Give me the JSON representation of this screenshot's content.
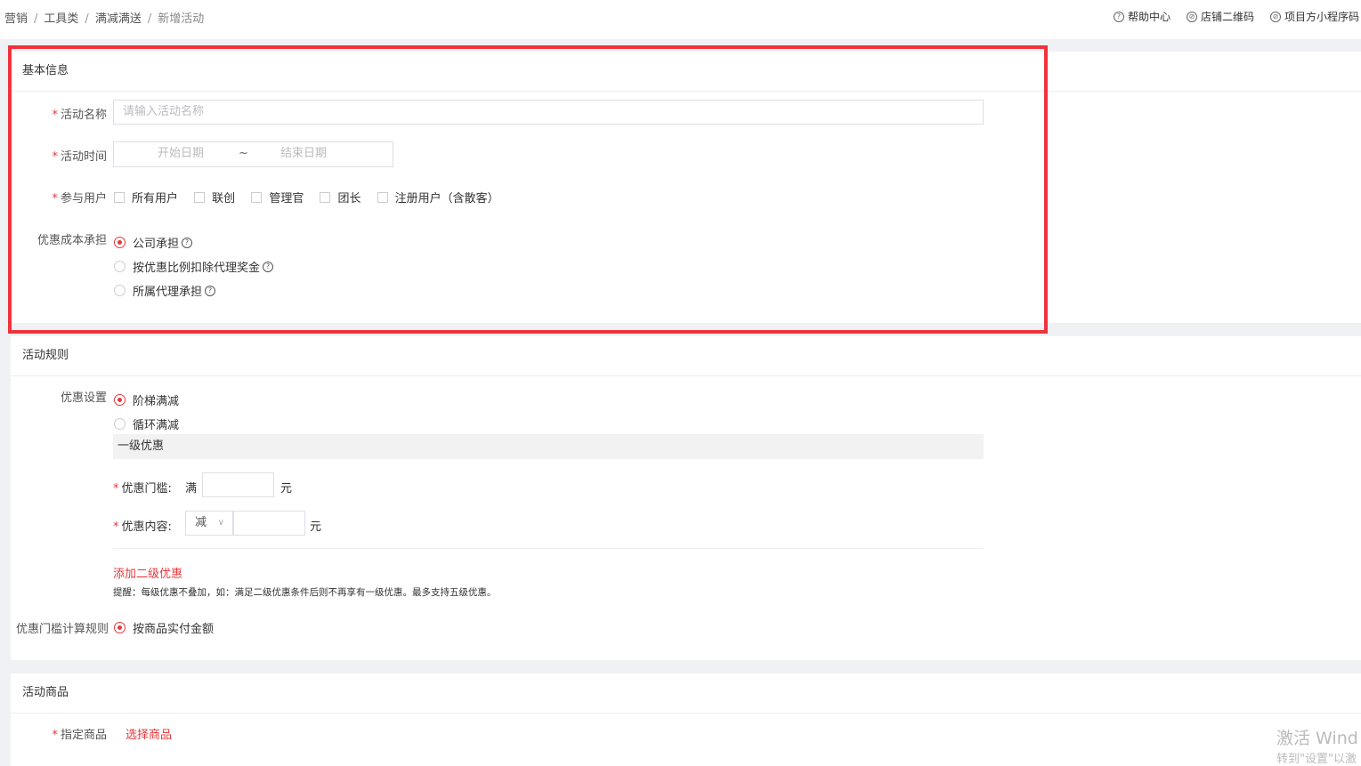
{
  "breadcrumb": [
    "营销",
    "工具类",
    "满减满送",
    "新增活动"
  ],
  "top_links": {
    "help": "帮助中心",
    "store_qr": "店铺二维码",
    "mini_qr": "项目方小程序码"
  },
  "basic": {
    "title": "基本信息",
    "name_label": "活动名称",
    "name_placeholder": "请输入活动名称",
    "time_label": "活动时间",
    "start_placeholder": "开始日期",
    "range_sep": "~",
    "end_placeholder": "结束日期",
    "users_label": "参与用户",
    "users_options": [
      "所有用户",
      "联创",
      "管理官",
      "团长",
      "注册用户（含散客）"
    ],
    "cost_label": "优惠成本承担",
    "cost_options": [
      "公司承担",
      "按优惠比例扣除代理奖金",
      "所属代理承担"
    ],
    "cost_selected": 0
  },
  "rules": {
    "title": "活动规则",
    "setting_label": "优惠设置",
    "setting_options": [
      "阶梯满减",
      "循环满减"
    ],
    "setting_selected": 0,
    "tier_title": "一级优惠",
    "threshold_label": "优惠门槛:",
    "threshold_prefix": "满",
    "threshold_unit": "元",
    "content_label": "优惠内容:",
    "content_select": "减",
    "content_unit": "元",
    "add_tier": "添加二级优惠",
    "hint": "提醒：每级优惠不叠加，如：满足二级优惠条件后则不再享有一级优惠。最多支持五级优惠。",
    "calc_label": "优惠门槛计算规则",
    "calc_option": "按商品实付金额"
  },
  "goods": {
    "title": "活动商品",
    "label": "指定商品",
    "select_link": "选择商品"
  },
  "watermark": {
    "line1": "激活 Wind",
    "line2": "转到\"设置\"以激"
  }
}
